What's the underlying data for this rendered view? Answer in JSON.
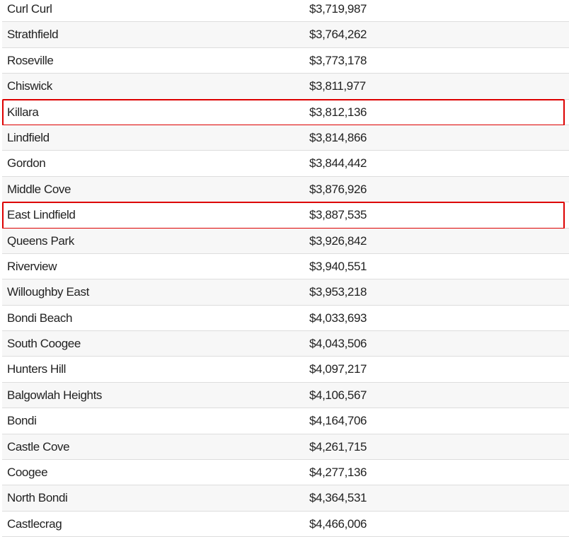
{
  "highlight_color": "#dd0000",
  "rows": [
    {
      "suburb": "Curl Curl",
      "price": "$3,719,987",
      "highlighted": false
    },
    {
      "suburb": "Strathfield",
      "price": "$3,764,262",
      "highlighted": false
    },
    {
      "suburb": "Roseville",
      "price": "$3,773,178",
      "highlighted": false
    },
    {
      "suburb": "Chiswick",
      "price": "$3,811,977",
      "highlighted": false
    },
    {
      "suburb": "Killara",
      "price": "$3,812,136",
      "highlighted": true
    },
    {
      "suburb": "Lindfield",
      "price": "$3,814,866",
      "highlighted": false
    },
    {
      "suburb": "Gordon",
      "price": "$3,844,442",
      "highlighted": false
    },
    {
      "suburb": "Middle Cove",
      "price": "$3,876,926",
      "highlighted": false
    },
    {
      "suburb": "East Lindfield",
      "price": "$3,887,535",
      "highlighted": true
    },
    {
      "suburb": "Queens Park",
      "price": "$3,926,842",
      "highlighted": false
    },
    {
      "suburb": "Riverview",
      "price": "$3,940,551",
      "highlighted": false
    },
    {
      "suburb": "Willoughby East",
      "price": "$3,953,218",
      "highlighted": false
    },
    {
      "suburb": "Bondi Beach",
      "price": "$4,033,693",
      "highlighted": false
    },
    {
      "suburb": "South Coogee",
      "price": "$4,043,506",
      "highlighted": false
    },
    {
      "suburb": "Hunters Hill",
      "price": "$4,097,217",
      "highlighted": false
    },
    {
      "suburb": "Balgowlah Heights",
      "price": "$4,106,567",
      "highlighted": false
    },
    {
      "suburb": "Bondi",
      "price": "$4,164,706",
      "highlighted": false
    },
    {
      "suburb": "Castle Cove",
      "price": "$4,261,715",
      "highlighted": false
    },
    {
      "suburb": "Coogee",
      "price": "$4,277,136",
      "highlighted": false
    },
    {
      "suburb": "North Bondi",
      "price": "$4,364,531",
      "highlighted": false
    },
    {
      "suburb": "Castlecrag",
      "price": "$4,466,006",
      "highlighted": false
    }
  ]
}
